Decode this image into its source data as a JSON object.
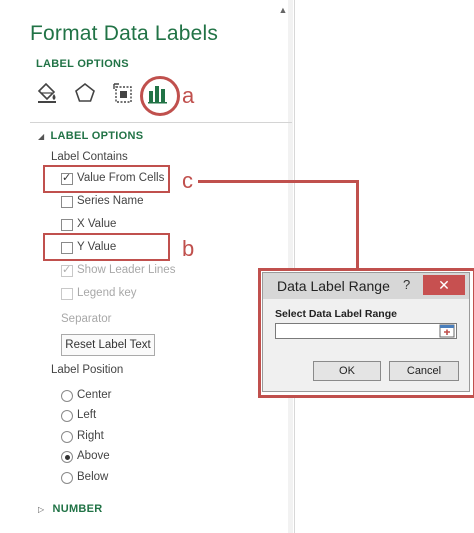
{
  "pane": {
    "title": "Format Data Labels",
    "options_tab": "LABEL OPTIONS"
  },
  "icons": [
    "fill-line-icon",
    "effects-pentagon-icon",
    "size-properties-icon",
    "label-options-bar-chart-icon"
  ],
  "callouts": {
    "a": "a",
    "b": "b",
    "c": "c"
  },
  "label_options": {
    "section_title": "LABEL OPTIONS",
    "contains_label": "Label Contains",
    "checkboxes": [
      {
        "label": "Value From Cells",
        "checked": true,
        "disabled": false
      },
      {
        "label": "Series Name",
        "checked": false,
        "disabled": false
      },
      {
        "label": "X Value",
        "checked": false,
        "disabled": false
      },
      {
        "label": "Y Value",
        "checked": false,
        "disabled": false
      },
      {
        "label": "Show Leader Lines",
        "checked": true,
        "disabled": true
      },
      {
        "label": "Legend key",
        "checked": false,
        "disabled": true
      }
    ],
    "separator_label": "Separator",
    "reset_button": "Reset Label Text",
    "position_label": "Label Position",
    "positions": [
      {
        "label": "Center",
        "selected": false
      },
      {
        "label": "Left",
        "selected": false
      },
      {
        "label": "Right",
        "selected": false
      },
      {
        "label": "Above",
        "selected": true
      },
      {
        "label": "Below",
        "selected": false
      }
    ]
  },
  "number_section": "NUMBER",
  "dialog": {
    "title": "Data Label Range",
    "help": "?",
    "close": "✕",
    "field_label": "Select Data Label Range",
    "field_value": "",
    "ok": "OK",
    "cancel": "Cancel"
  },
  "colors": {
    "accent_green": "#217346",
    "callout_red": "#c0504d"
  }
}
